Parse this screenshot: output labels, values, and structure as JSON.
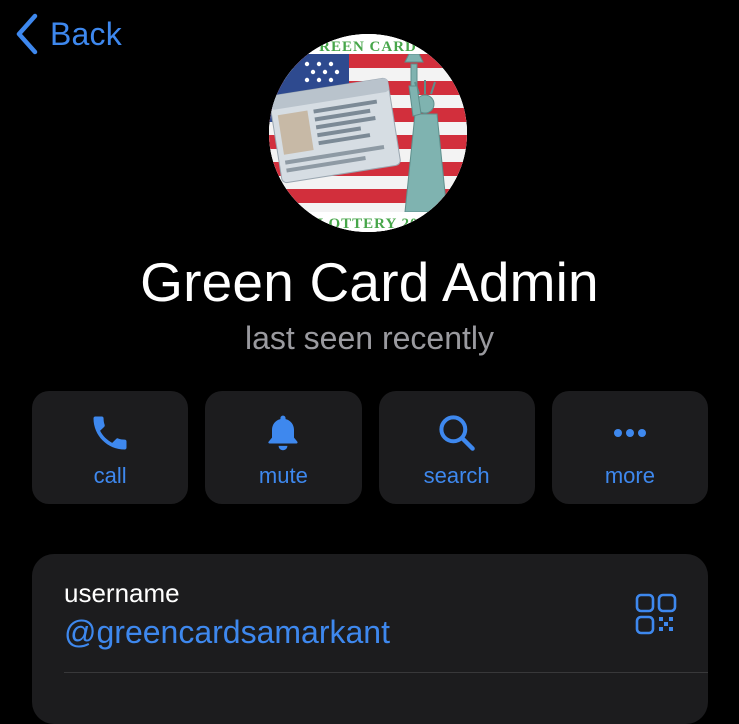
{
  "nav": {
    "back_label": "Back"
  },
  "profile": {
    "avatar_icon": "green-card-lottery-avatar",
    "name": "Green Card Admin",
    "status": "last seen recently"
  },
  "actions": [
    {
      "label": "call",
      "icon": "phone-icon"
    },
    {
      "label": "mute",
      "icon": "bell-icon"
    },
    {
      "label": "search",
      "icon": "search-icon"
    },
    {
      "label": "more",
      "icon": "more-dots-icon"
    }
  ],
  "info": {
    "username_label": "username",
    "username_value": "@greencardsamarkant",
    "qr_icon": "qr-code-icon"
  },
  "colors": {
    "background": "#000000",
    "card": "#1c1c1e",
    "accent": "#3e88ee",
    "secondary_text": "#9a9a9f"
  }
}
